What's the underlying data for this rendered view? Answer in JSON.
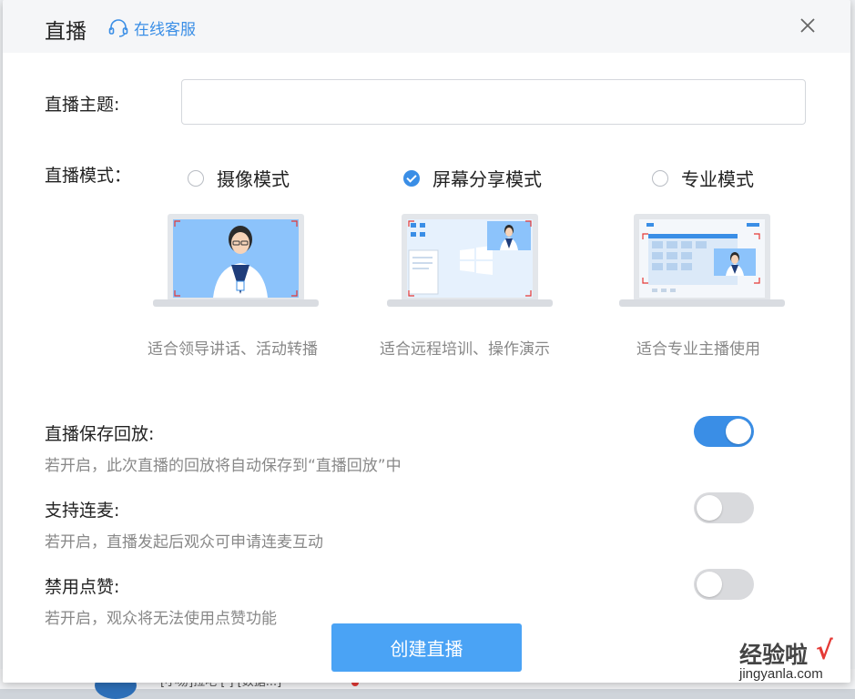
{
  "dialog": {
    "title": "直播",
    "service_label": "在线客服"
  },
  "form": {
    "topic_label": "直播主题:",
    "topic_value": "",
    "mode_label": "直播模式："
  },
  "modes": [
    {
      "label": "摄像模式",
      "checked": false,
      "caption": "适合领导讲话、活动转播"
    },
    {
      "label": "屏幕分享模式",
      "checked": true,
      "caption": "适合远程培训、操作演示"
    },
    {
      "label": "专业模式",
      "checked": false,
      "caption": "适合专业主播使用"
    }
  ],
  "options": [
    {
      "title": "直播保存回放:",
      "desc": "若开启，此次直播的回放将自动保存到“直播回放”中",
      "on": true
    },
    {
      "title": "支持连麦:",
      "desc": "若开启，直播发起后观众可申请连麦互动",
      "on": false
    },
    {
      "title": "禁用点赞:",
      "desc": "若开启，观众将无法使用点赞功能",
      "on": false
    }
  ],
  "create_button": "创建直播",
  "background": {
    "bottom_text": "[小易]拉吧 [ ] [数据...]"
  },
  "watermark": {
    "line1": "经验啦",
    "check": "√",
    "line2": "jingyanla.com"
  },
  "colors": {
    "accent": "#3a8ee6",
    "button": "#4aa3f5",
    "switch_off": "#d9dadd"
  }
}
